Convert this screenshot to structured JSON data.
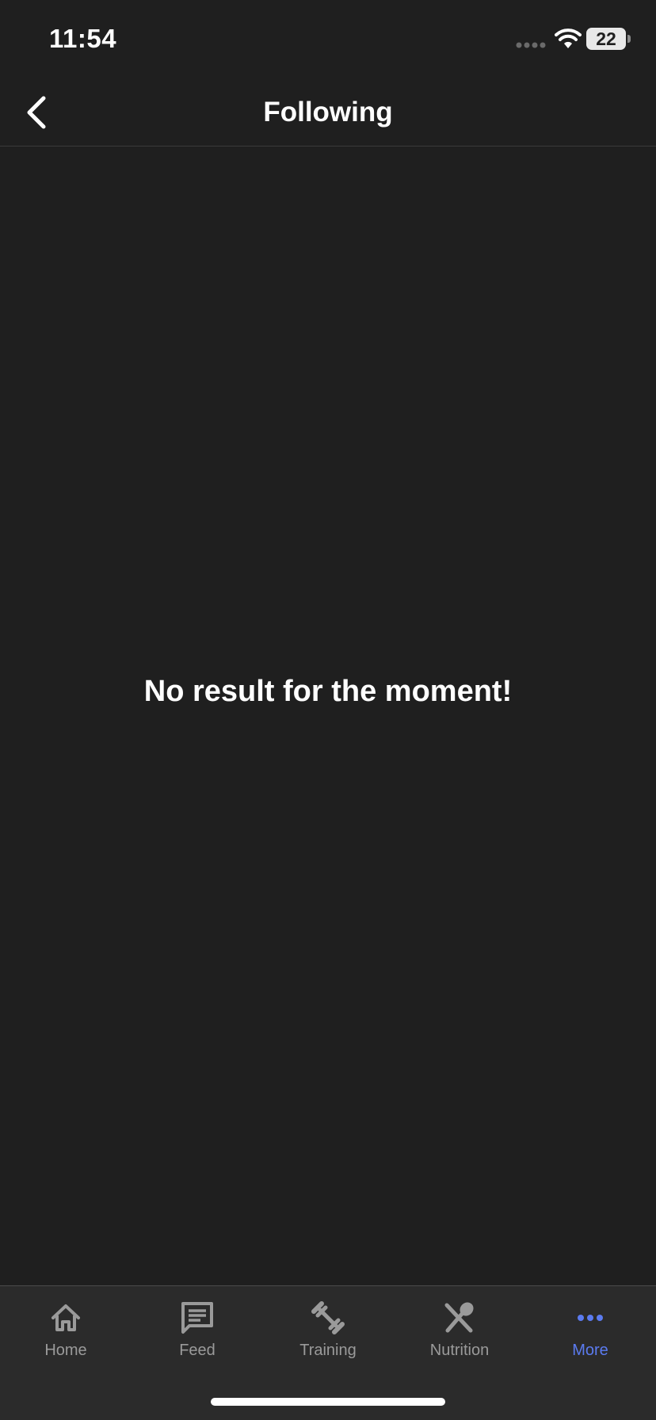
{
  "status_bar": {
    "time": "11:54",
    "battery_level": "22"
  },
  "nav": {
    "title": "Following",
    "back_icon": "chevron-left-icon"
  },
  "main": {
    "empty_message": "No result for the moment!"
  },
  "tab_bar": {
    "tabs": [
      {
        "label": "Home",
        "icon": "home-icon"
      },
      {
        "label": "Feed",
        "icon": "feed-icon"
      },
      {
        "label": "Training",
        "icon": "dumbbell-icon"
      },
      {
        "label": "Nutrition",
        "icon": "utensils-icon"
      },
      {
        "label": "More",
        "icon": "more-icon"
      }
    ],
    "active_index": 4
  },
  "colors": {
    "background": "#1f1f1f",
    "tab_bar_background": "#2b2b2b",
    "accent": "#5b7bf0",
    "inactive": "#9a9a9a",
    "text": "#ffffff"
  }
}
